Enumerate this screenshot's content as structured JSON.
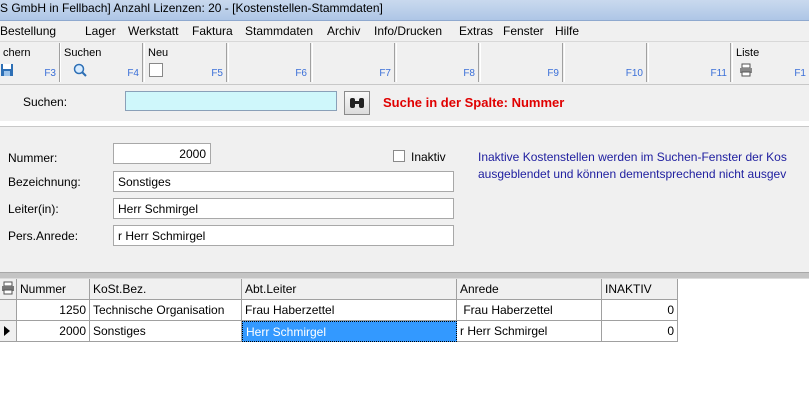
{
  "window": {
    "title": "S GmbH in Fellbach] Anzahl Lizenzen: 20 - [Kostenstellen-Stammdaten]"
  },
  "menu": [
    "Bestellung",
    "Lager",
    "Werkstatt",
    "Faktura",
    "Stammdaten",
    "Archiv",
    "Info/Drucken",
    "Extras",
    "Fenster",
    "Hilfe"
  ],
  "toolbar": [
    {
      "label": "chern",
      "key": "F3",
      "icon": "save-icon"
    },
    {
      "label": "Suchen",
      "key": "F4",
      "icon": "magnifier-icon"
    },
    {
      "label": "Neu",
      "key": "F5",
      "icon": "new-checkbox-icon"
    },
    {
      "label": "",
      "key": "F6"
    },
    {
      "label": "",
      "key": "F7"
    },
    {
      "label": "",
      "key": "F8"
    },
    {
      "label": "",
      "key": "F9"
    },
    {
      "label": "",
      "key": "F10"
    },
    {
      "label": "",
      "key": "F11"
    },
    {
      "label": "Liste",
      "key": "F1",
      "icon": "printer-icon"
    }
  ],
  "search": {
    "label": "Suchen:",
    "value": "",
    "hint": "Suche in der Spalte: Nummer",
    "button_icon": "binoculars-icon"
  },
  "form": {
    "nummer_label": "Nummer:",
    "nummer_value": "2000",
    "bezeichnung_label": "Bezeichnung:",
    "bezeichnung_value": "Sonstiges",
    "leiter_label": "Leiter(in):",
    "leiter_value": "Herr Schmirgel",
    "anrede_label": "Pers.Anrede:",
    "anrede_value": "r Herr Schmirgel",
    "inaktiv_label": "Inaktiv",
    "inaktiv_checked": false,
    "info_line1": "Inaktive Kostenstellen werden im Suchen-Fenster der Kos",
    "info_line2": "ausgeblendet und können dementsprechend nicht ausgev"
  },
  "grid": {
    "columns": [
      "Nummer",
      "KoSt.Bez.",
      "Abt.Leiter",
      "Anrede",
      "INAKTIV"
    ],
    "rows": [
      {
        "nummer": "1250",
        "bez": "Technische Organisation",
        "leiter": "Frau Haberzettel",
        "anrede": " Frau Haberzettel",
        "inaktiv": "0"
      },
      {
        "nummer": "2000",
        "bez": "Sonstiges",
        "leiter": "Herr Schmirgel",
        "anrede": "r Herr Schmirgel",
        "inaktiv": "0"
      }
    ]
  },
  "colors": {
    "search_bg": "#cff7fb",
    "hint": "#e00000",
    "info": "#2020a0",
    "selection": "#3399ff"
  }
}
